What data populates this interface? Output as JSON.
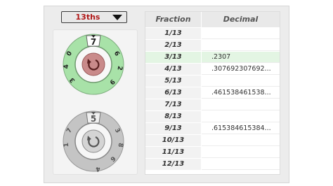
{
  "dropdown": {
    "value": "13ths"
  },
  "dial_top": {
    "top_value": "7",
    "labels_left": [
      "0",
      "4",
      "3"
    ],
    "labels_right": [
      "6",
      "2",
      "9"
    ],
    "color": "#a8e2a8"
  },
  "dial_bottom": {
    "top_value": "5",
    "labels_left": [
      "7",
      "1"
    ],
    "labels_right": [
      "3",
      "8",
      "6",
      "4"
    ],
    "color": "#c4c4c4"
  },
  "table": {
    "headers": {
      "fraction": "Fraction",
      "decimal": "Decimal"
    },
    "rows": [
      {
        "fraction": "1/13",
        "decimal": ""
      },
      {
        "fraction": "2/13",
        "decimal": ""
      },
      {
        "fraction": "3/13",
        "decimal": ".2307",
        "highlighted": true
      },
      {
        "fraction": "4/13",
        "decimal": ".307692307692..."
      },
      {
        "fraction": "5/13",
        "decimal": ""
      },
      {
        "fraction": "6/13",
        "decimal": ".461538461538..."
      },
      {
        "fraction": "7/13",
        "decimal": ""
      },
      {
        "fraction": "8/13",
        "decimal": ""
      },
      {
        "fraction": "9/13",
        "decimal": ".615384615384..."
      },
      {
        "fraction": "10/13",
        "decimal": ""
      },
      {
        "fraction": "11/13",
        "decimal": ""
      },
      {
        "fraction": "12/13",
        "decimal": ""
      }
    ]
  }
}
